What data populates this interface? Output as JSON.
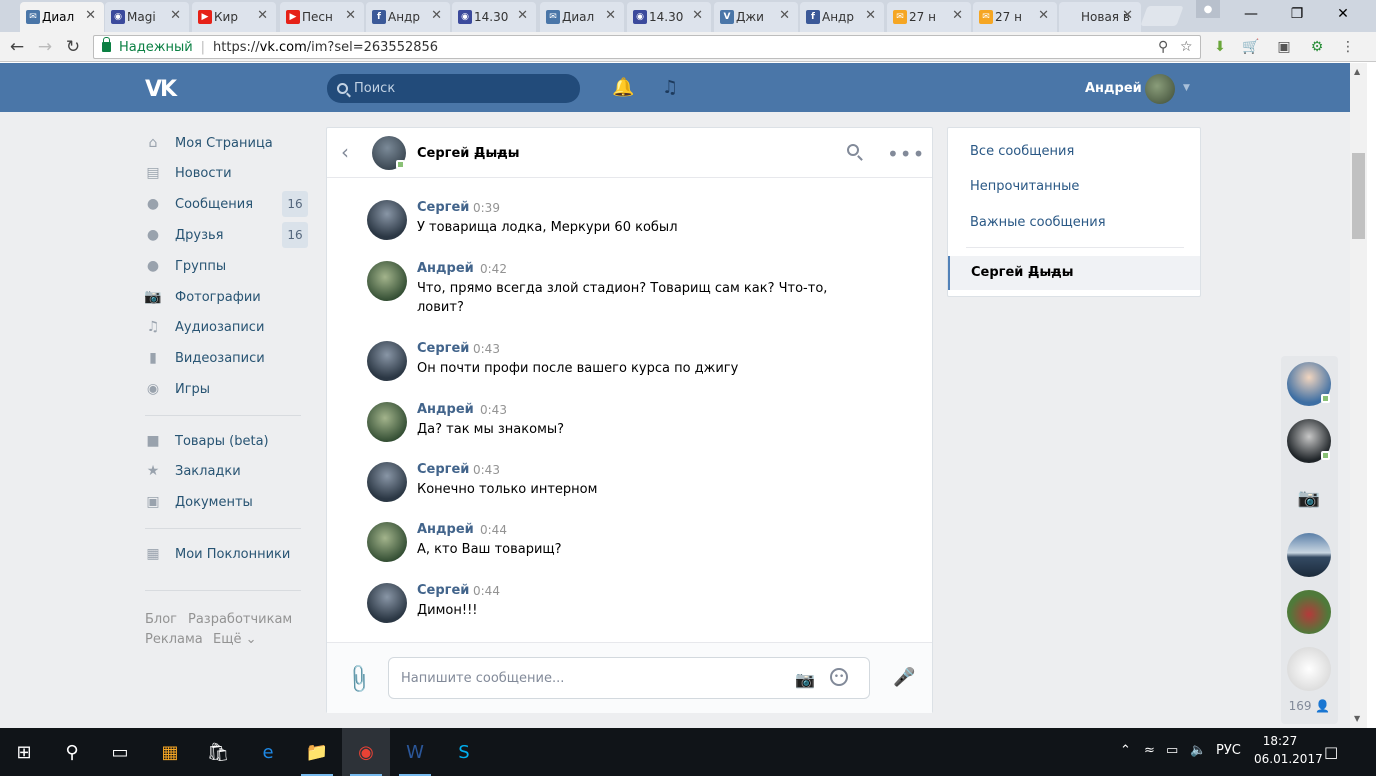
{
  "browser": {
    "tabs": [
      {
        "label": "Диал",
        "favicon": "vk-message-icon",
        "color": "#4a76a8",
        "active": true
      },
      {
        "label": "Magi",
        "favicon": "eye-icon",
        "color": "#3b4a9c"
      },
      {
        "label": "Кир",
        "favicon": "youtube-icon",
        "color": "#e62117"
      },
      {
        "label": "Песн",
        "favicon": "youtube-icon",
        "color": "#e62117"
      },
      {
        "label": "Андр",
        "favicon": "facebook-icon",
        "color": "#3b5998"
      },
      {
        "label": "14.30",
        "favicon": "eye-icon",
        "color": "#3b4a9c"
      },
      {
        "label": "Диал",
        "favicon": "vk-message-icon",
        "color": "#4a76a8"
      },
      {
        "label": "14.30",
        "favicon": "eye-icon",
        "color": "#3b4a9c"
      },
      {
        "label": "Джи",
        "favicon": "vk-icon",
        "color": "#4a76a8"
      },
      {
        "label": "Андр",
        "favicon": "facebook-icon",
        "color": "#3b5998"
      },
      {
        "label": "27 н",
        "favicon": "mail-icon",
        "color": "#f5a623"
      },
      {
        "label": "27 н",
        "favicon": "mail-icon",
        "color": "#f5a623"
      },
      {
        "label": "Новая в",
        "favicon": "none",
        "color": "#dde3ec"
      }
    ],
    "address": {
      "secure_label": "Надежный",
      "url_scheme": "https://",
      "url_host": "vk.com",
      "url_path": "/im?sel=263552856"
    }
  },
  "vk": {
    "header": {
      "search_placeholder": "Поиск",
      "user_name": "Андрей"
    },
    "nav": [
      {
        "label": "Моя Страница",
        "icon": "home-icon"
      },
      {
        "label": "Новости",
        "icon": "news-icon"
      },
      {
        "label": "Сообщения",
        "icon": "messages-icon",
        "count": "16"
      },
      {
        "label": "Друзья",
        "icon": "friends-icon",
        "count": "16"
      },
      {
        "label": "Группы",
        "icon": "groups-icon"
      },
      {
        "label": "Фотографии",
        "icon": "camera-icon"
      },
      {
        "label": "Аудиозаписи",
        "icon": "music-icon"
      },
      {
        "label": "Видеозаписи",
        "icon": "video-icon"
      },
      {
        "label": "Игры",
        "icon": "gamepad-icon"
      },
      {
        "label": "Товары (beta)",
        "icon": "bag-icon"
      },
      {
        "label": "Закладки",
        "icon": "star-icon"
      },
      {
        "label": "Документы",
        "icon": "document-icon"
      },
      {
        "label": "Мои Поклонники",
        "icon": "apps-icon"
      }
    ],
    "footer": {
      "blog": "Блог",
      "devs": "Разработчикам",
      "ads": "Реклама",
      "more": "Ещё"
    },
    "chat": {
      "peer_name": "Сергей Д̶ы̶д̶ы̶",
      "messages": [
        {
          "author": "Сергей",
          "time": "0:39",
          "text": "У товарища лодка, Меркури 60 кобыл",
          "who": "s"
        },
        {
          "author": "Андрей",
          "time": "0:42",
          "text": "Что, прямо всегда злой стадион? Товарищ сам как? Что-то, ловит?",
          "who": "a"
        },
        {
          "author": "Сергей",
          "time": "0:43",
          "text": "Он почти профи после вашего курса по джигу",
          "who": "s"
        },
        {
          "author": "Андрей",
          "time": "0:43",
          "text": "Да? так мы знакомы?",
          "who": "a"
        },
        {
          "author": "Сергей",
          "time": "0:43",
          "text": "Конечно только интерном",
          "who": "s"
        },
        {
          "author": "Андрей",
          "time": "0:44",
          "text": "А, кто Ваш товарищ?",
          "who": "a"
        },
        {
          "author": "Сергей",
          "time": "0:44",
          "text": "Димон!!!",
          "who": "s"
        }
      ],
      "composer_placeholder": "Напишите сообщение..."
    },
    "filters": {
      "all": "Все сообщения",
      "unread": "Непрочитанные",
      "important": "Важные сообщения",
      "active_peer": "Сергей Д̶ы̶д̶ы̶"
    },
    "friends_count": "169"
  },
  "taskbar": {
    "lang": "РУС",
    "time": "18:27",
    "date": "06.01.2017"
  }
}
